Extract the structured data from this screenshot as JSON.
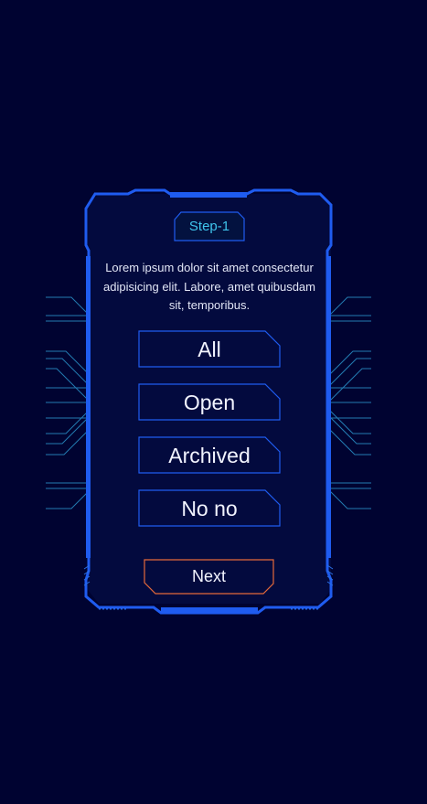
{
  "step": {
    "label": "Step-1"
  },
  "description": "Lorem ipsum dolor sit amet consectetur adipisicing elit. Labore, amet quibusdam sit, temporibus.",
  "options": [
    {
      "label": "All"
    },
    {
      "label": "Open"
    },
    {
      "label": "Archived"
    },
    {
      "label": "No no"
    }
  ],
  "next_button": {
    "label": "Next"
  },
  "colors": {
    "background": "#000331",
    "panel": "#030a3e",
    "frame": "#1f5cf0",
    "accent_cyan": "#3fc4ec",
    "next_border": "#e5693a"
  }
}
